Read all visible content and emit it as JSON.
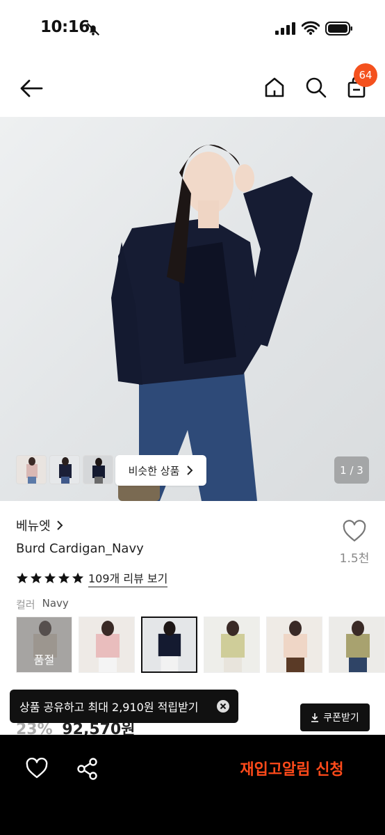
{
  "status_bar": {
    "time": "10:16"
  },
  "nav": {
    "cart_count": "64"
  },
  "gallery": {
    "similar_button_label": "비슷한 상품",
    "page_indicator": "1 / 3"
  },
  "product": {
    "brand": "베뉴엣",
    "name": "Burd Cardigan_Navy",
    "wish_count": "1.5천",
    "rating_stars": 5,
    "review_link": "109개 리뷰 보기"
  },
  "color": {
    "label": "컬러",
    "selected": "Navy",
    "soldout_label": "품절"
  },
  "price": {
    "discount": "23%",
    "value": "92,570원"
  },
  "toast": {
    "message": "상품 공유하고 최대 2,910원 적립받기"
  },
  "coupon_button": "쿠폰받기",
  "bottom_bar": {
    "restock_label": "재입고알림 신청"
  },
  "colors": {
    "accent": "#f4511e",
    "restock": "#ff4a1a"
  }
}
